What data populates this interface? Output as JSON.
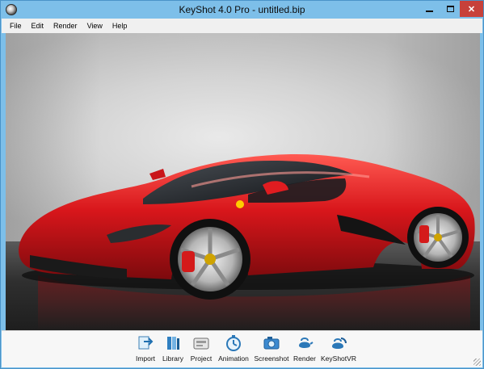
{
  "window": {
    "title": "KeyShot 4.0 Pro  - untitled.bip",
    "controls": {
      "minimize": "",
      "maximize": "",
      "close": "✕"
    }
  },
  "menubar": {
    "items": [
      {
        "label": "File"
      },
      {
        "label": "Edit"
      },
      {
        "label": "Render"
      },
      {
        "label": "View"
      },
      {
        "label": "Help"
      }
    ]
  },
  "viewport": {
    "scene": "red sports car render"
  },
  "toolbar": {
    "buttons": [
      {
        "label": "Import",
        "icon": "import-icon"
      },
      {
        "label": "Library",
        "icon": "library-icon"
      },
      {
        "label": "Project",
        "icon": "project-icon"
      },
      {
        "label": "Animation",
        "icon": "animation-icon"
      },
      {
        "label": "Screenshot",
        "icon": "screenshot-icon"
      },
      {
        "label": "Render",
        "icon": "render-icon"
      },
      {
        "label": "KeyShotVR",
        "icon": "keyshotvr-icon"
      }
    ]
  },
  "colors": {
    "titlebar": "#7dbfe9",
    "close_button": "#c7413a",
    "car_body": "#d8161b",
    "menubar": "#f0f0f0"
  }
}
